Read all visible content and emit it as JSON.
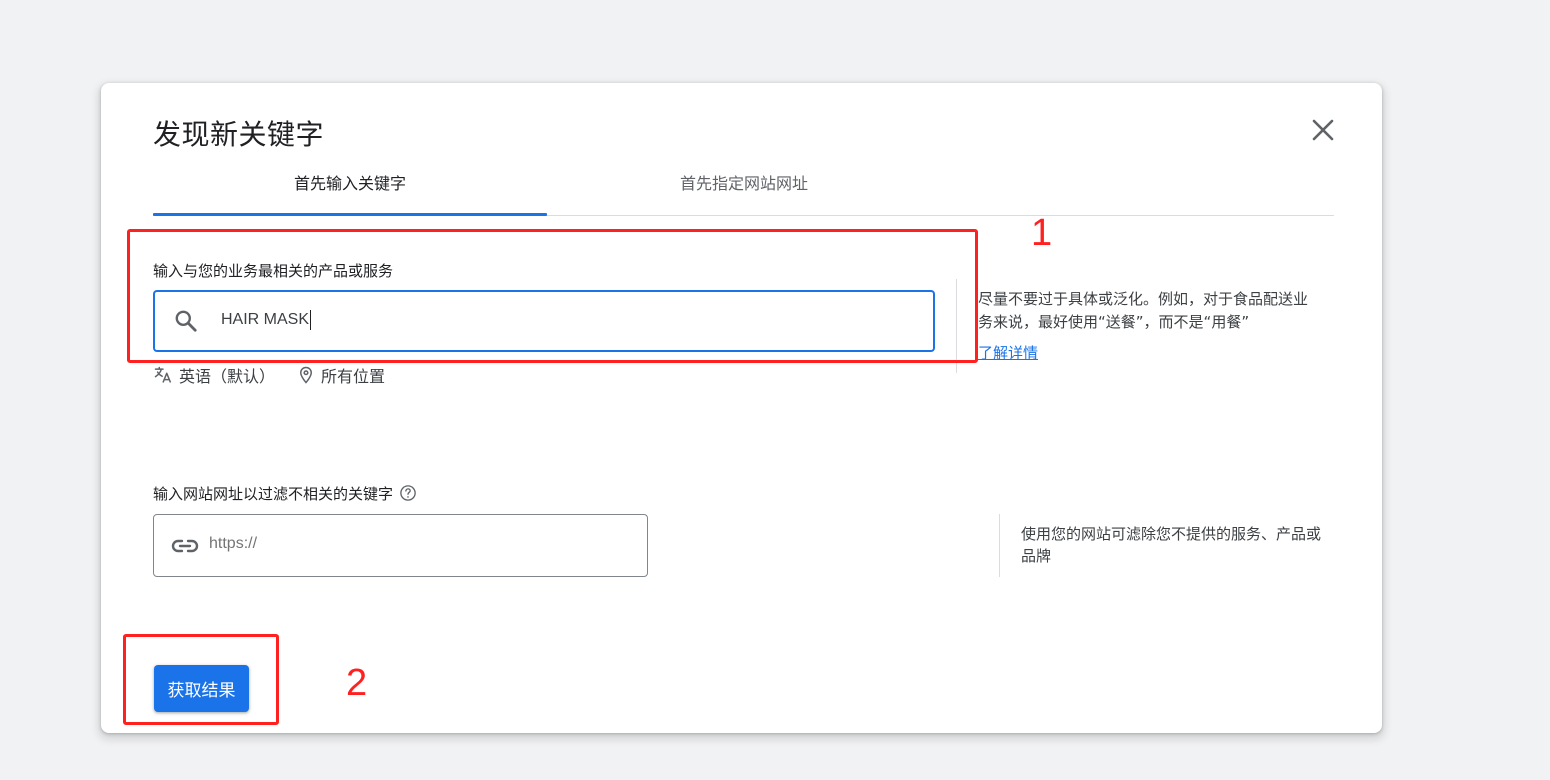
{
  "dialog": {
    "title": "发现新关键字",
    "close_icon": "close-icon",
    "tabs": [
      {
        "label": "首先输入关键字",
        "active": true
      },
      {
        "label": "首先指定网站网址",
        "active": false
      }
    ]
  },
  "keyword_section": {
    "label": "输入与您的业务最相关的产品或服务",
    "value": "HAIR MASK",
    "icon": "search-icon",
    "language": "英语（默认）",
    "location": "所有位置",
    "hint": "尽量不要过于具体或泛化。例如，对于食品配送业务来说，最好使用“送餐”，而不是“用餐”",
    "learn_more": "了解详情"
  },
  "website_section": {
    "label": "输入网站网址以过滤不相关的关键字",
    "placeholder": "https://",
    "icon": "link-icon",
    "hint": "使用您的网站可滤除您不提供的服务、产品或品牌"
  },
  "submit_button": "获取结果",
  "annotations": [
    {
      "number": "1"
    },
    {
      "number": "2"
    }
  ],
  "colors": {
    "accent": "#1a73e8",
    "annotation": "#ff2020",
    "background": "#f1f2f4"
  }
}
